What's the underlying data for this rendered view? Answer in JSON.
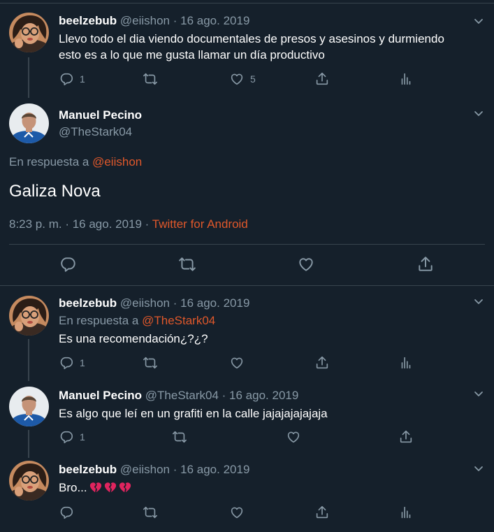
{
  "colors": {
    "background": "#15202b",
    "border": "#38444d",
    "muted": "#8899a6",
    "link": "#e0582b"
  },
  "tweets": [
    {
      "name": "beelzebub",
      "handle": "@eiishon",
      "sep": "·",
      "date": "16 ago. 2019",
      "text_line1": "Llevo todo el dia viendo documentales de presos y asesinos y durmiendo",
      "text_line2": "esto es a lo que me gusta llamar un día productivo",
      "reply_count": "1",
      "like_count": "5"
    },
    {
      "name": "Manuel Pecino",
      "handle": "@TheStark04",
      "reply_prefix": "En respuesta a",
      "reply_handle": "@eiishon",
      "text": "Galiza Nova",
      "time": "8:23 p. m. · 16 ago. 2019 ·",
      "source": "Twitter for Android"
    },
    {
      "name": "beelzebub",
      "handle": "@eiishon",
      "sep": "·",
      "date": "16 ago. 2019",
      "reply_prefix": "En respuesta a",
      "reply_handle": "@TheStark04",
      "text": "Es una recomendación¿?¿?",
      "reply_count": "1"
    },
    {
      "name": "Manuel Pecino",
      "handle": "@TheStark04",
      "sep": "·",
      "date": "16 ago. 2019",
      "text": "Es algo que leí en un grafiti en la calle jajajajajajaja",
      "reply_count": "1"
    },
    {
      "name": "beelzebub",
      "handle": "@eiishon",
      "sep": "·",
      "date": "16 ago. 2019",
      "text": "Bro...",
      "emojis": [
        "broken-heart-icon",
        "broken-heart-icon",
        "broken-heart-icon"
      ]
    }
  ]
}
